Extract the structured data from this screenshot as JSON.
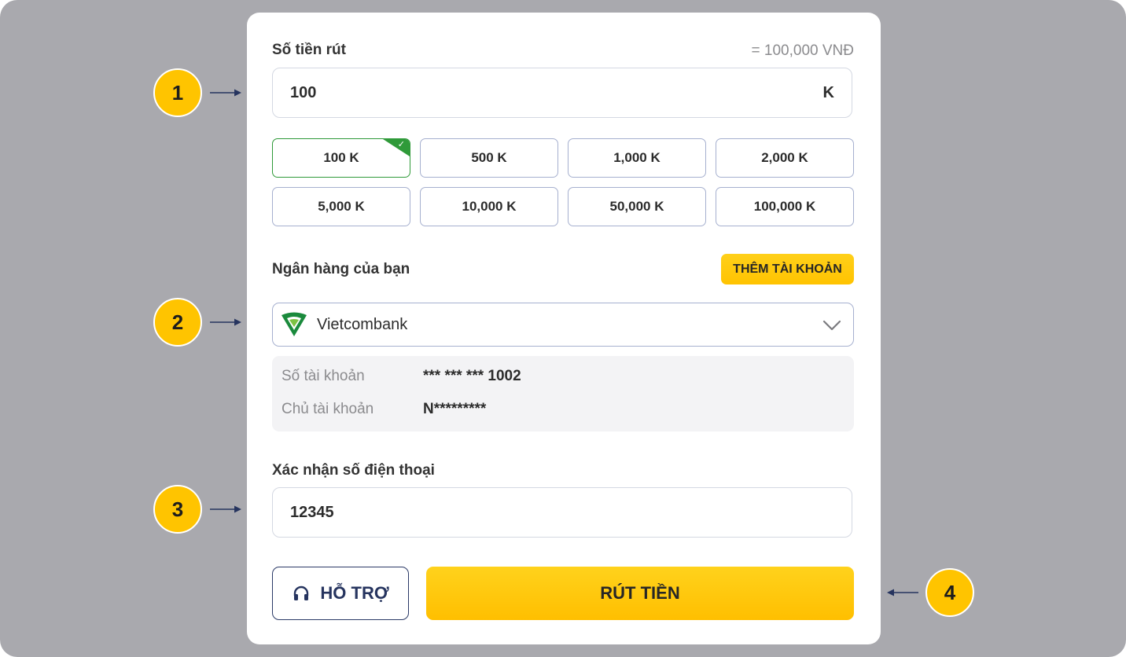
{
  "amount": {
    "label": "Số tiền rút",
    "converted": "= 100,000 VNĐ",
    "value": "100",
    "unit": "K"
  },
  "chips": [
    {
      "label": "100 K",
      "selected": true
    },
    {
      "label": "500 K",
      "selected": false
    },
    {
      "label": "1,000 K",
      "selected": false
    },
    {
      "label": "2,000 K",
      "selected": false
    },
    {
      "label": "5,000 K",
      "selected": false
    },
    {
      "label": "10,000 K",
      "selected": false
    },
    {
      "label": "50,000 K",
      "selected": false
    },
    {
      "label": "100,000 K",
      "selected": false
    }
  ],
  "bank": {
    "label": "Ngân hàng của bạn",
    "add_button": "THÊM TÀI KHOẢN",
    "selected": "Vietcombank",
    "account_number_label": "Số tài khoản",
    "account_number": "*** *** *** 1002",
    "account_holder_label": "Chủ tài khoản",
    "account_holder": "N*********"
  },
  "phone": {
    "label": "Xác nhận số điện thoại",
    "value": "12345"
  },
  "actions": {
    "support": "HỖ TRỢ",
    "withdraw": "RÚT TIỀN"
  },
  "steps": [
    "1",
    "2",
    "3",
    "4"
  ],
  "colors": {
    "accent": "#ffc400",
    "selected_border": "#2f9a39",
    "navy": "#26345f",
    "background": "#a9a9ae"
  }
}
